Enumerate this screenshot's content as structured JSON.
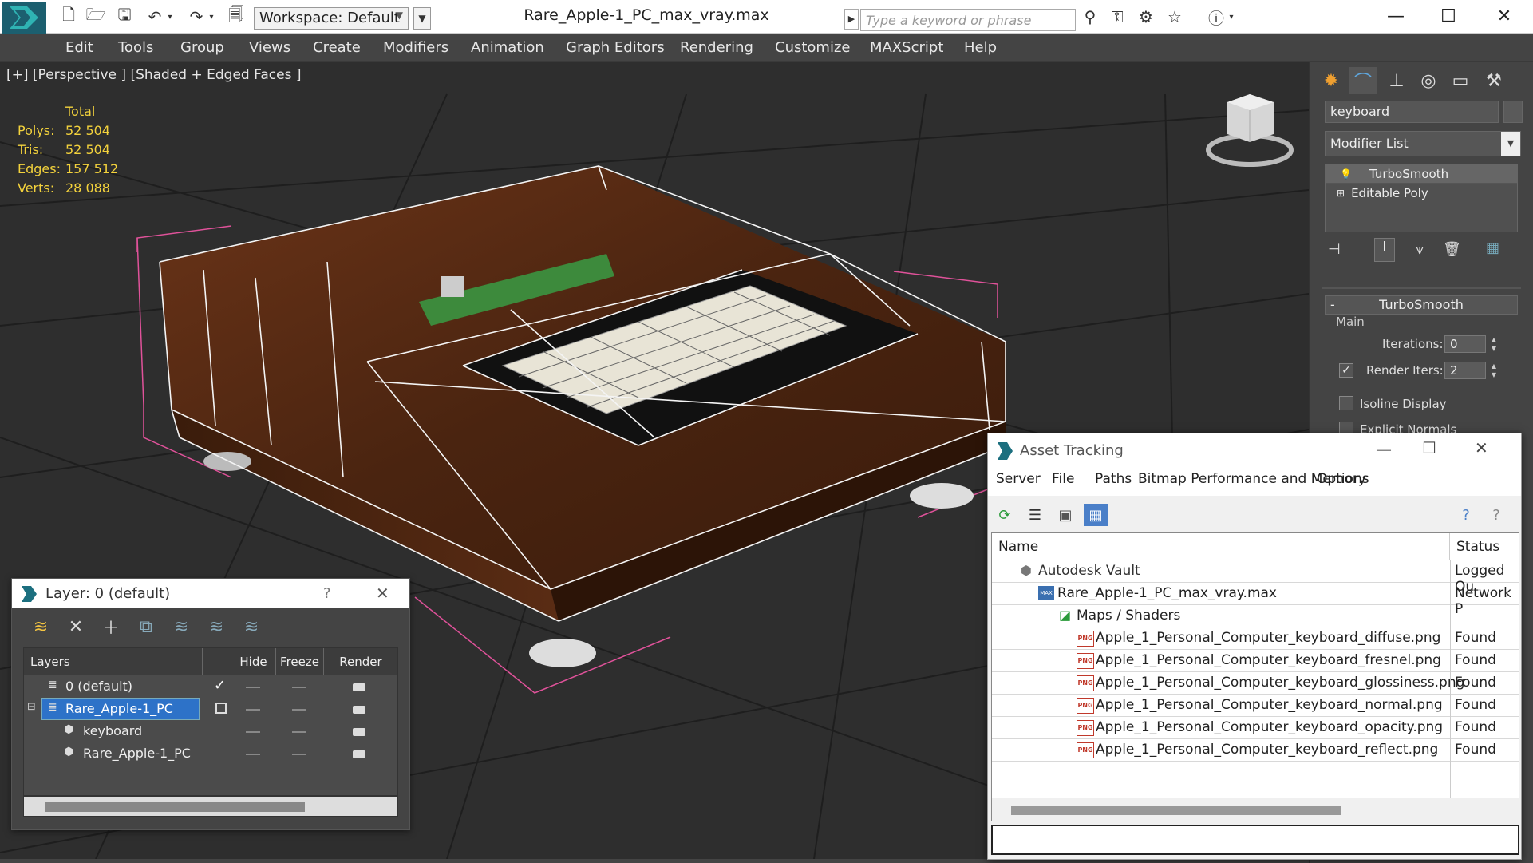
{
  "app": {
    "workspace_label": "Workspace: Default",
    "doc_title": "Rare_Apple-1_PC_max_vray.max",
    "search_placeholder": "Type a keyword or phrase"
  },
  "menu": [
    "Edit",
    "Tools",
    "Group",
    "Views",
    "Create",
    "Modifiers",
    "Animation",
    "Graph Editors",
    "Rendering",
    "Customize",
    "MAXScript",
    "Help"
  ],
  "viewport": {
    "label": "[+] [Perspective ] [Shaded + Edged Faces ]",
    "stats_header": "Total",
    "stats": [
      {
        "label": "Polys:",
        "value": "52 504"
      },
      {
        "label": "Tris:",
        "value": "52 504"
      },
      {
        "label": "Edges:",
        "value": "157 512"
      },
      {
        "label": "Verts:",
        "value": "28 088"
      }
    ]
  },
  "command_panel": {
    "object_name": "keyboard",
    "modifier_list": "Modifier List",
    "stack": [
      "TurboSmooth",
      "Editable Poly"
    ],
    "rollout_title": "TurboSmooth",
    "group_main": "Main",
    "iterations_label": "Iterations:",
    "iterations_value": "0",
    "render_iters_label": "Render Iters:",
    "render_iters_value": "2",
    "isoline_label": "Isoline Display",
    "explicit_label": "Explicit Normals"
  },
  "layer_panel": {
    "title": "Layer: 0 (default)",
    "help": "?",
    "columns": [
      "Layers",
      "Hide",
      "Freeze",
      "Render"
    ],
    "rows": [
      {
        "name": "0 (default)"
      },
      {
        "name": "Rare_Apple-1_PC"
      },
      {
        "name": "keyboard"
      },
      {
        "name": "Rare_Apple-1_PC"
      }
    ]
  },
  "asset_tracking": {
    "title": "Asset Tracking",
    "menu": [
      "Server",
      "File",
      "Paths",
      "Bitmap Performance and Memory",
      "Options"
    ],
    "columns": [
      "Name",
      "Status"
    ],
    "rows": [
      {
        "name": "Autodesk Vault",
        "status": "Logged Ou"
      },
      {
        "name": "Rare_Apple-1_PC_max_vray.max",
        "status": "Network P"
      },
      {
        "name": "Maps / Shaders",
        "status": ""
      },
      {
        "name": "Apple_1_Personal_Computer_keyboard_diffuse.png",
        "status": "Found"
      },
      {
        "name": "Apple_1_Personal_Computer_keyboard_fresnel.png",
        "status": "Found"
      },
      {
        "name": "Apple_1_Personal_Computer_keyboard_glossiness.png",
        "status": "Found"
      },
      {
        "name": "Apple_1_Personal_Computer_keyboard_normal.png",
        "status": "Found"
      },
      {
        "name": "Apple_1_Personal_Computer_keyboard_opacity.png",
        "status": "Found"
      },
      {
        "name": "Apple_1_Personal_Computer_keyboard_reflect.png",
        "status": "Found"
      }
    ],
    "png_badge": "PNG"
  }
}
